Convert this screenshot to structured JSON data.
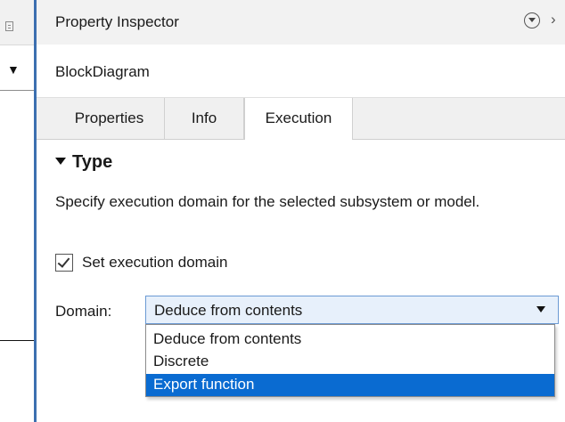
{
  "panel": {
    "title": "Property Inspector",
    "block_name": "BlockDiagram",
    "tabs": [
      {
        "label": "Properties",
        "active": false
      },
      {
        "label": "Info",
        "active": false
      },
      {
        "label": "Execution",
        "active": true
      }
    ],
    "section": {
      "title": "Type",
      "description": "Specify execution domain for the selected subsystem or model.",
      "checkbox_label": "Set execution domain",
      "checkbox_checked": true,
      "domain_label": "Domain:",
      "domain_value": "Deduce from contents",
      "domain_options": [
        "Deduce from contents",
        "Discrete",
        "Export function"
      ],
      "highlighted_option": "Export function"
    }
  },
  "icons": [
    "collapse-icon",
    "close-icon",
    "dropdown-arrow-icon",
    "checkmark-icon"
  ],
  "colors": {
    "accent": "#0a6bd1",
    "select_bg": "#e7f0fb",
    "divider": "#3c6fb0",
    "title_bar_bg": "#f2f2f2"
  }
}
